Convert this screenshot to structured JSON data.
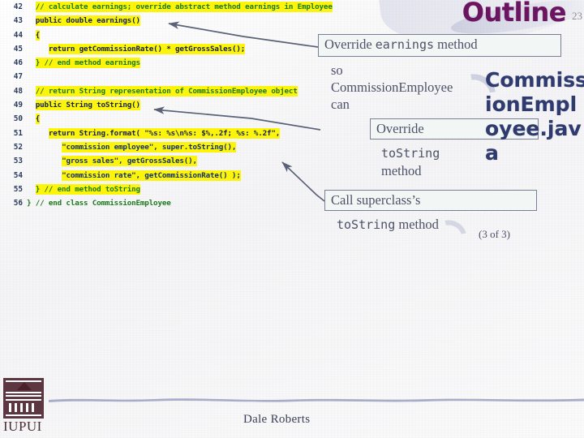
{
  "header": {
    "title": "Outline",
    "page_number": "23"
  },
  "filename_overlay": "CommissionEmployee.java",
  "code": {
    "lines": [
      {
        "num": "42",
        "indent": 2,
        "segments": [
          {
            "text": "// calculate earnings; override abstract method earnings in Employee",
            "cls": "cmt",
            "hl": true
          }
        ]
      },
      {
        "num": "43",
        "indent": 2,
        "segments": [
          {
            "text": "public double earnings()",
            "cls": "kw",
            "hl": true
          }
        ]
      },
      {
        "num": "44",
        "indent": 2,
        "segments": [
          {
            "text": "{",
            "cls": "plain",
            "hl": true
          }
        ]
      },
      {
        "num": "45",
        "indent": 5,
        "segments": [
          {
            "text": "return getCommissionRate() * getGrossSales();",
            "cls": "kw",
            "hl": true
          }
        ]
      },
      {
        "num": "46",
        "indent": 2,
        "segments": [
          {
            "text": "} // end method earnings",
            "cls": "cmt",
            "hl": true
          }
        ]
      },
      {
        "num": "47",
        "indent": 2,
        "segments": []
      },
      {
        "num": "48",
        "indent": 2,
        "segments": [
          {
            "text": "// return String representation of CommissionEmployee object",
            "cls": "cmt",
            "hl": true
          }
        ]
      },
      {
        "num": "49",
        "indent": 2,
        "segments": [
          {
            "text": "public String toString()",
            "cls": "kw",
            "hl": true
          }
        ]
      },
      {
        "num": "50",
        "indent": 2,
        "segments": [
          {
            "text": "{",
            "cls": "plain",
            "hl": true
          }
        ]
      },
      {
        "num": "51",
        "indent": 5,
        "segments": [
          {
            "text": "return String.format( \"%s: %s\\n%s: $%,.2f; %s: %.2f\",",
            "cls": "kw",
            "hl": true
          }
        ]
      },
      {
        "num": "52",
        "indent": 8,
        "segments": [
          {
            "text": "\"commission employee\", super.toString(),",
            "cls": "str",
            "hl": true
          }
        ]
      },
      {
        "num": "53",
        "indent": 8,
        "segments": [
          {
            "text": "\"gross sales\", getGrossSales(),",
            "cls": "str",
            "hl": true
          }
        ]
      },
      {
        "num": "54",
        "indent": 8,
        "segments": [
          {
            "text": "\"commission rate\", getCommissionRate() );",
            "cls": "str",
            "hl": true
          }
        ]
      },
      {
        "num": "55",
        "indent": 2,
        "segments": [
          {
            "text": "} // end method toString",
            "cls": "cmt",
            "hl": true
          }
        ]
      },
      {
        "num": "56",
        "indent": 0,
        "segments": [
          {
            "text": "} // end class CommissionEmployee",
            "cls": "cmt",
            "hl": false
          }
        ]
      }
    ]
  },
  "callouts": {
    "one": {
      "box_text_a": "Override ",
      "box_text_mono": "earnings",
      "box_text_b": " method",
      "overflow_line1": "so",
      "overflow_line2": "CommissionEmployee",
      "overflow_line3": "can"
    },
    "two": {
      "box_text": "Override",
      "overflow_mono": "toString",
      "overflow_tail": "method"
    },
    "three": {
      "box_text": "Call superclass’s",
      "overflow_mono": "toString",
      "overflow_tail": "method"
    }
  },
  "slide_count": "(3 of 3)",
  "footer": {
    "author": "Dale Roberts",
    "logo_text": "IUPUI"
  },
  "colors": {
    "highlight": "#fcf40a",
    "comment": "#1b7a1b",
    "keyword": "#13204a",
    "title": "#6b1560",
    "filename": "#2f3a6e",
    "callout_border": "#7a7f96",
    "callout_fill": "#f2f7f5",
    "background": "#f8f8f9"
  }
}
